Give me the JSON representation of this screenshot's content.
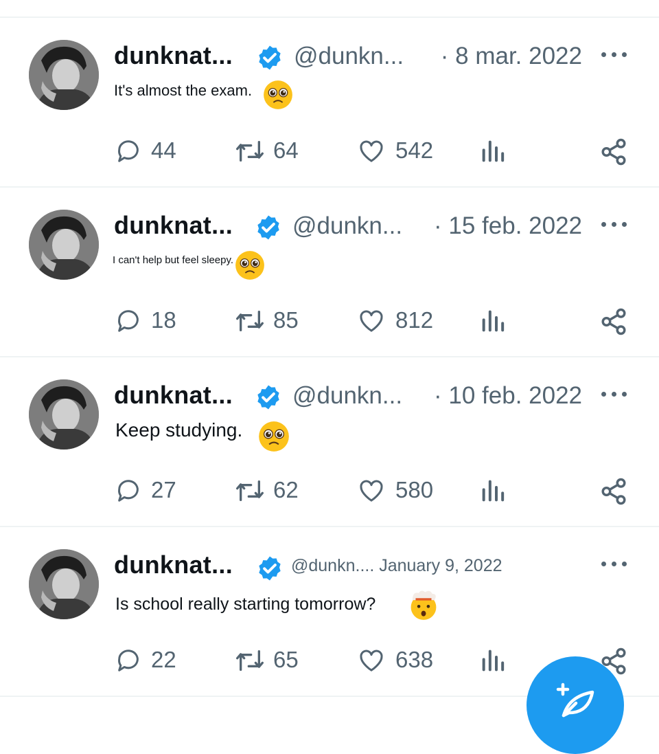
{
  "colors": {
    "accent": "#1d9bf0",
    "text": "#0f1419",
    "muted": "#536471",
    "divider": "#eff3f4"
  },
  "tweets": [
    {
      "name": "dunknat...",
      "handle": "@dunkn...",
      "date": "· 8 mar. 2022",
      "text": "It's almost the exam.",
      "emoji": "pleading-face",
      "replies": "44",
      "retweets": "64",
      "likes": "542"
    },
    {
      "name": "dunknat...",
      "handle": "@dunkn...",
      "date": "· 15 feb. 2022",
      "text": "I can't help but feel sleepy.",
      "emoji": "pleading-face",
      "replies": "18",
      "retweets": "85",
      "likes": "812"
    },
    {
      "name": "dunknat...",
      "handle": "@dunkn...",
      "date": "· 10 feb. 2022",
      "text": "Keep studying.",
      "emoji": "pleading-face",
      "replies": "27",
      "retweets": "62",
      "likes": "580"
    },
    {
      "name": "dunknat...",
      "handle": "@dunkn.... January 9, 2022",
      "date": "",
      "text": "Is school really starting tomorrow?",
      "emoji": "exploding-head",
      "replies": "22",
      "retweets": "65",
      "likes": "638"
    }
  ],
  "icons": {
    "reply": "reply-icon",
    "retweet": "retweet-icon",
    "like": "heart-icon",
    "views": "views-icon",
    "share": "share-icon",
    "more": "more-icon",
    "verified": "verified-badge-icon",
    "compose": "compose-icon"
  }
}
